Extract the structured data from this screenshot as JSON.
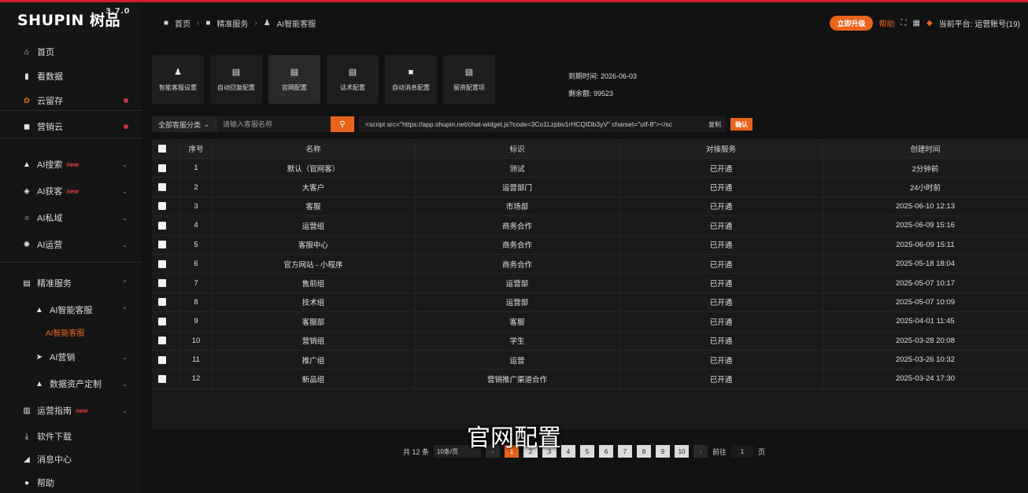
{
  "app": {
    "logo": "SHUPIN 树品",
    "version": "3.7.0"
  },
  "sidebar": {
    "items": [
      {
        "label": "首页",
        "icon": "home-icon",
        "glyph": "⌂"
      },
      {
        "label": "看数据",
        "icon": "bar-chart-icon",
        "glyph": "▮"
      },
      {
        "label": "云留存",
        "icon": "flower-icon",
        "glyph": "✿",
        "color": "#e8641b",
        "dot": true
      },
      {
        "label": "营销云",
        "icon": "briefcase-icon",
        "glyph": "◼",
        "dot": true
      },
      {
        "label": "AI搜索",
        "icon": "thumb-icon",
        "glyph": "▲",
        "badge": "new",
        "chevron": "⌄"
      },
      {
        "label": "AI获客",
        "icon": "tag-icon",
        "glyph": "◈",
        "badge": "new",
        "chevron": "⌄"
      },
      {
        "label": "AI私域",
        "icon": "search-icon",
        "glyph": "○",
        "chevron": "⌄"
      },
      {
        "label": "AI运营",
        "icon": "gear-icon",
        "glyph": "✺",
        "chevron": "⌄"
      },
      {
        "label": "精准服务",
        "icon": "folder-icon",
        "glyph": "▤",
        "chevron": "⌃"
      },
      {
        "label": "AI智能客服",
        "icon": "user-icon",
        "glyph": "▲",
        "chevron": "⌃",
        "sub": true
      },
      {
        "label": "AI智能客服",
        "active_sub": true
      },
      {
        "label": "AI营销",
        "icon": "send-icon",
        "glyph": "➤",
        "chevron": "⌄",
        "sub": true
      },
      {
        "label": "数据资产定制",
        "icon": "home-icon",
        "glyph": "▲",
        "chevron": "⌄",
        "sub": true
      },
      {
        "label": "运营指南",
        "icon": "book-icon",
        "glyph": "▥",
        "badge": "new",
        "chevron": "⌄"
      },
      {
        "label": "软件下载",
        "icon": "download-icon",
        "glyph": "⤓"
      },
      {
        "label": "消息中心",
        "icon": "bell-icon",
        "glyph": "◢"
      },
      {
        "label": "帮助",
        "icon": "help-icon",
        "glyph": "●"
      }
    ]
  },
  "breadcrumb": [
    "首页",
    "精准服务",
    "AI智能客服"
  ],
  "header": {
    "upgrade": "立即升级",
    "link": "帮助",
    "user": "当前平台: 运营账号(19)"
  },
  "cards": [
    {
      "label": "智能客服设置",
      "icon": "user-icon",
      "glyph": "♟"
    },
    {
      "label": "自动回复配置",
      "icon": "doc-icon",
      "glyph": "▤"
    },
    {
      "label": "官网配置",
      "icon": "doc-icon",
      "glyph": "▤",
      "active": true
    },
    {
      "label": "话术配置",
      "icon": "doc-icon",
      "glyph": "▤"
    },
    {
      "label": "自动消息配置",
      "icon": "message-icon",
      "glyph": "■"
    },
    {
      "label": "留资配置项",
      "icon": "doc-icon",
      "glyph": "▤"
    }
  ],
  "expiry": {
    "date_label": "到期时间: 2026-06-03",
    "count_label": "剩余额: 99523"
  },
  "filter": {
    "select": "全部客服分类",
    "placeholder": "请输入客服名称",
    "code": "<script src=\"https://app.shupin.net/chat-widget.js?code=3Co1Lzpbv1rHCQIDb3yV\" charset=\"utf-8\"></sc",
    "copy": "复制",
    "confirm": "确认"
  },
  "table": {
    "headers": [
      "序号",
      "名称",
      "标识",
      "对接服务",
      "创建时间"
    ],
    "rows": [
      [
        "1",
        "默认（官网客）",
        "测试",
        "已开通",
        "2分钟前"
      ],
      [
        "2",
        "大客户",
        "运营部门",
        "已开通",
        "24小时前"
      ],
      [
        "3",
        "客服",
        "市场部",
        "已开通",
        "2025-06-10 12:13"
      ],
      [
        "4",
        "运营组",
        "商务合作",
        "已开通",
        "2025-06-09 15:16"
      ],
      [
        "5",
        "客服中心",
        "商务合作",
        "已开通",
        "2025-06-09 15:11"
      ],
      [
        "6",
        "官方网站 - 小程序",
        "商务合作",
        "已开通",
        "2025-05-18 18:04"
      ],
      [
        "7",
        "售前组",
        "运营部",
        "已开通",
        "2025-05-07 10:17"
      ],
      [
        "8",
        "技术组",
        "运营部",
        "已开通",
        "2025-05-07 10:09"
      ],
      [
        "9",
        "客服部",
        "客服",
        "已开通",
        "2025-04-01 11:45"
      ],
      [
        "10",
        "营销组",
        "学生",
        "已开通",
        "2025-03-28 20:08"
      ],
      [
        "11",
        "推广组",
        "运营",
        "已开通",
        "2025-03-26 10:32"
      ],
      [
        "12",
        "新品组",
        "营销推广渠道合作",
        "已开通",
        "2025-03-24 17:30"
      ]
    ]
  },
  "pager": {
    "total": "共 12 条",
    "per_page": "10条/页",
    "pages": [
      "1",
      "2",
      "3",
      "4",
      "5",
      "6",
      "7",
      "8",
      "9",
      "10"
    ],
    "goto_label": "前往",
    "goto_value": "1",
    "page_unit": "页"
  },
  "subtitle": "官网配置"
}
